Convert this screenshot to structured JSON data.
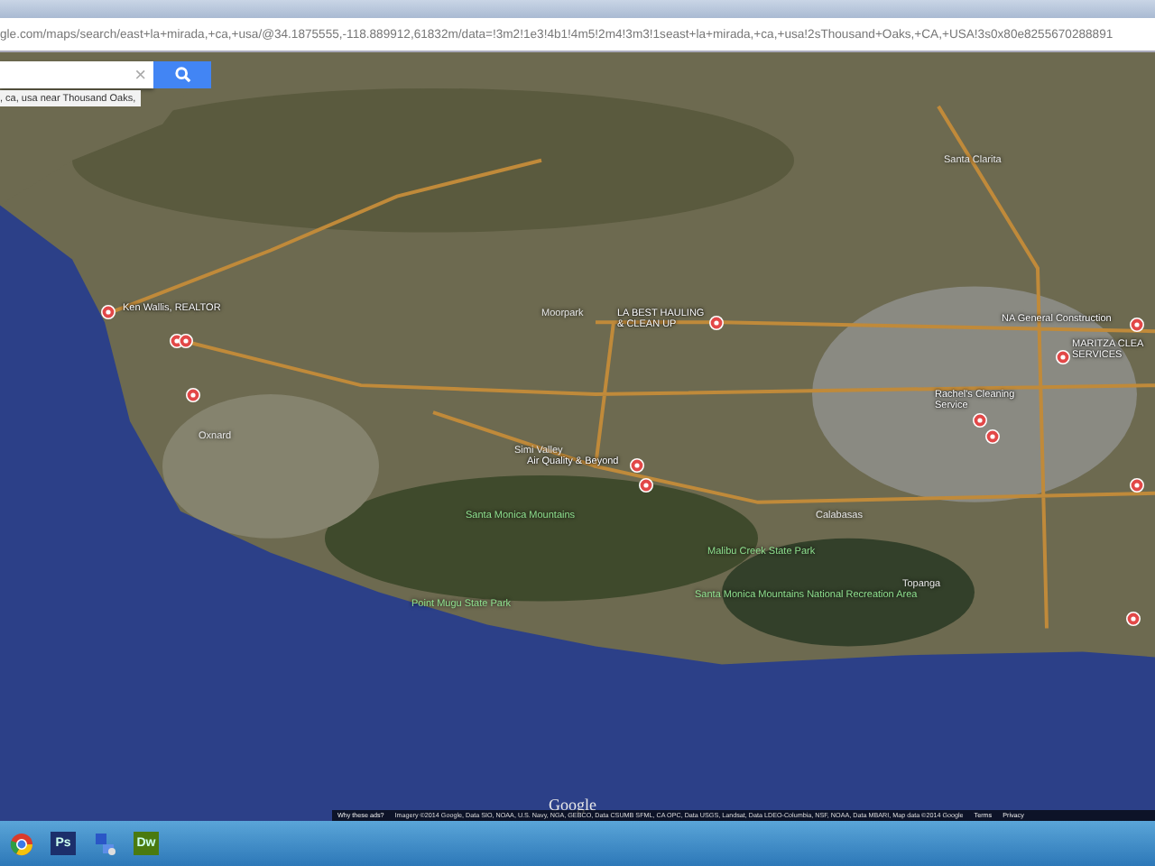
{
  "browser": {
    "url": "gle.com/maps/search/east+la+mirada,+ca,+usa/@34.1875555,-118.889912,61832m/data=!3m2!1e3!4b1!4m5!2m4!3m3!1seast+la+mirada,+ca,+usa!2sThousand+Oaks,+CA,+USA!3s0x80e8255670288891"
  },
  "search": {
    "clear_glyph": "×",
    "suggestion": ", ca, usa near Thousand Oaks,"
  },
  "map": {
    "places": [
      {
        "kind": "town",
        "name": "Santa Clarita"
      },
      {
        "kind": "town",
        "name": "Moorpark"
      },
      {
        "kind": "town",
        "name": "Simi Valley"
      },
      {
        "kind": "town",
        "name": "Oxnard"
      },
      {
        "kind": "town",
        "name": "Calabasas"
      },
      {
        "kind": "town",
        "name": "Topanga"
      },
      {
        "kind": "park",
        "name": "Santa Monica Mountains"
      },
      {
        "kind": "park",
        "name": "Point Mugu State Park"
      },
      {
        "kind": "park",
        "name": "Malibu Creek State Park"
      },
      {
        "kind": "park",
        "name": "Santa Monica Mountains National Recreation Area"
      }
    ],
    "markers": [
      {
        "kind": "pin",
        "lines": [
          "Ken Wallis, REALTOR"
        ]
      },
      {
        "kind": "pin"
      },
      {
        "kind": "pin"
      },
      {
        "kind": "pin"
      },
      {
        "kind": "pin",
        "lines": [
          "LA BEST HAULING",
          "& CLEAN UP"
        ]
      },
      {
        "kind": "pin",
        "lines": [
          "Air Quality & Beyond"
        ]
      },
      {
        "kind": "pin"
      },
      {
        "kind": "pin",
        "lines": [
          "NA General Construction"
        ]
      },
      {
        "kind": "pin",
        "lines": [
          "MARITZA CLEA",
          "SERVICES"
        ]
      },
      {
        "kind": "pin",
        "lines": [
          "Rachel's Cleaning",
          "Service"
        ]
      },
      {
        "kind": "pin"
      },
      {
        "kind": "pin"
      },
      {
        "kind": "pin"
      }
    ],
    "logo": "Google",
    "attribution": {
      "ads_link": "Why these ads?",
      "credits": "Imagery ©2014 Google, Data SIO, NOAA, U.S. Navy, NGA, GEBCO, Data CSUMB SFML, CA OPC, Data USGS, Landsat, Data LDEO-Columbia, NSF, NOAA, Data MBARI, Map data ©2014 Google",
      "links": [
        "Terms",
        "Privacy"
      ]
    }
  },
  "taskbar": {
    "apps": [
      {
        "kind": "browser"
      },
      {
        "kind": "badge",
        "label": "Ps",
        "color": "#1c2f6b"
      },
      {
        "kind": "network"
      },
      {
        "kind": "badge",
        "label": "Dw",
        "color": "#4a7a10"
      }
    ]
  }
}
